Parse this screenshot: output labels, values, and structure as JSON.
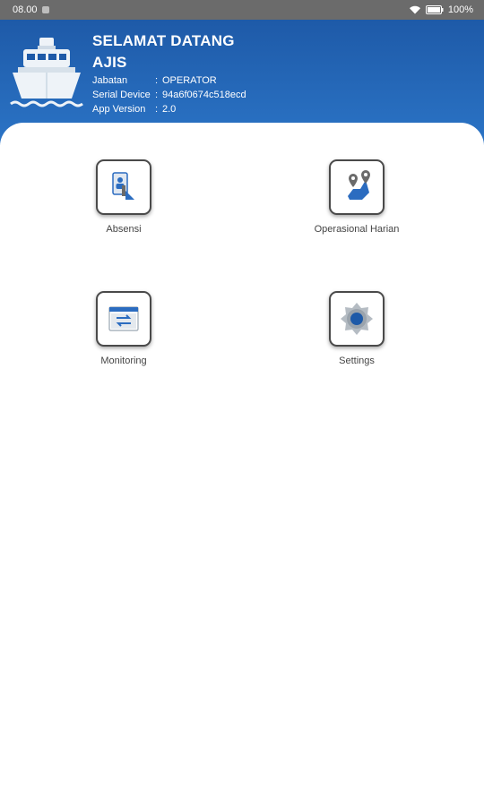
{
  "status_bar": {
    "time": "08.00",
    "battery": "100%"
  },
  "header": {
    "greeting": "SELAMAT DATANG",
    "user_name": "AJIS",
    "info": [
      {
        "label": "Jabatan",
        "value": "OPERATOR"
      },
      {
        "label": "Serial Device",
        "value": "94a6f0674c518ecd"
      },
      {
        "label": "App Version",
        "value": "2.0"
      }
    ],
    "separator": ":"
  },
  "menu": [
    {
      "label": "Absensi",
      "icon": "attendance-icon"
    },
    {
      "label": "Operasional Harian",
      "icon": "route-map-icon"
    },
    {
      "label": "Monitoring",
      "icon": "monitoring-window-icon"
    },
    {
      "label": "Settings",
      "icon": "gear-icon"
    }
  ],
  "colors": {
    "header_top": "#1e5aa8",
    "header_bottom": "#2b74c6",
    "accent": "#2b6cc0",
    "status_bar": "#6b6b6b"
  }
}
